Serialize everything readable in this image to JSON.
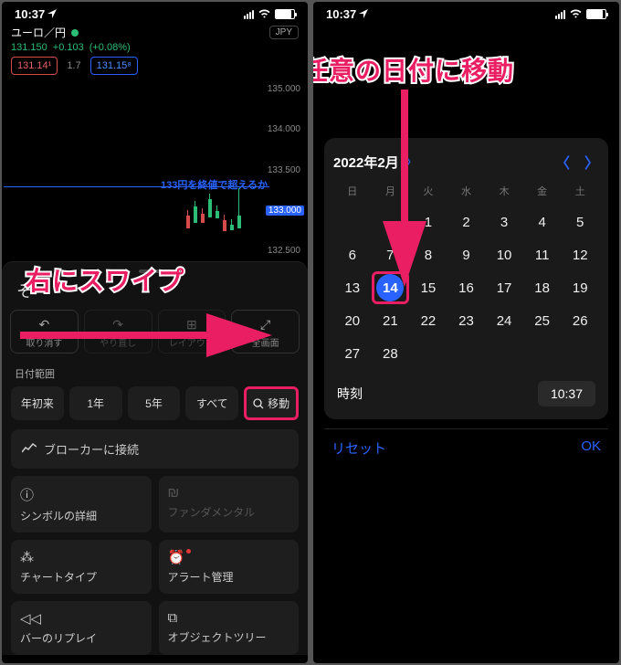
{
  "annotations": {
    "swipe_right": "右にスワイプ",
    "go_to_date": "任意の日付に移動"
  },
  "status": {
    "time": "10:37",
    "location_icon": "location-arrow"
  },
  "left": {
    "symbol": "ユーロ／円",
    "currency_badge": "JPY",
    "last": "131.150",
    "change": "+0.103",
    "change_pct": "(+0.08%)",
    "bid": "131.14¹",
    "spread": "1.7",
    "ask": "131.15⁸",
    "trend_label": "133円を終値で超えるか",
    "axis": [
      "135.000",
      "134.000",
      "133.500",
      "133.000",
      "132.500"
    ],
    "axis_highlight_index": 3,
    "sheet_hint": "そ",
    "actions": [
      {
        "icon": "↶",
        "label": "取り消す"
      },
      {
        "icon": "↷",
        "label": "やり直し",
        "dim": true
      },
      {
        "icon": "⊞",
        "label": "レイアウト",
        "dim": true
      },
      {
        "icon": "⤢",
        "label": "全画面"
      }
    ],
    "range_section": "日付範囲",
    "ranges": [
      "年初来",
      "1年",
      "5年",
      "すべて"
    ],
    "move_label": "移動",
    "broker_connect": "ブローカーに接続",
    "grid": [
      {
        "icon": "ⓘ",
        "label": "シンボルの詳細",
        "dim": false
      },
      {
        "icon": "₪",
        "label": "ファンダメンタル",
        "dim": true
      },
      {
        "icon": "⁂",
        "label": "チャートタイプ",
        "dim": false
      },
      {
        "icon": "⏰",
        "label": "アラート管理",
        "dim": false,
        "reddot": true
      },
      {
        "icon": "◁◁",
        "label": "バーのリプレイ",
        "dim": false
      },
      {
        "icon": "⧉",
        "label": "オブジェクトツリー",
        "dim": false
      }
    ]
  },
  "right": {
    "month_label": "2022年2月",
    "dow": [
      "日",
      "月",
      "火",
      "水",
      "木",
      "金",
      "土"
    ],
    "leading_blanks": 2,
    "days_in_month": 28,
    "selected_day": 14,
    "time_label": "時刻",
    "time_value": "10:37",
    "reset": "リセット",
    "ok": "OK"
  }
}
